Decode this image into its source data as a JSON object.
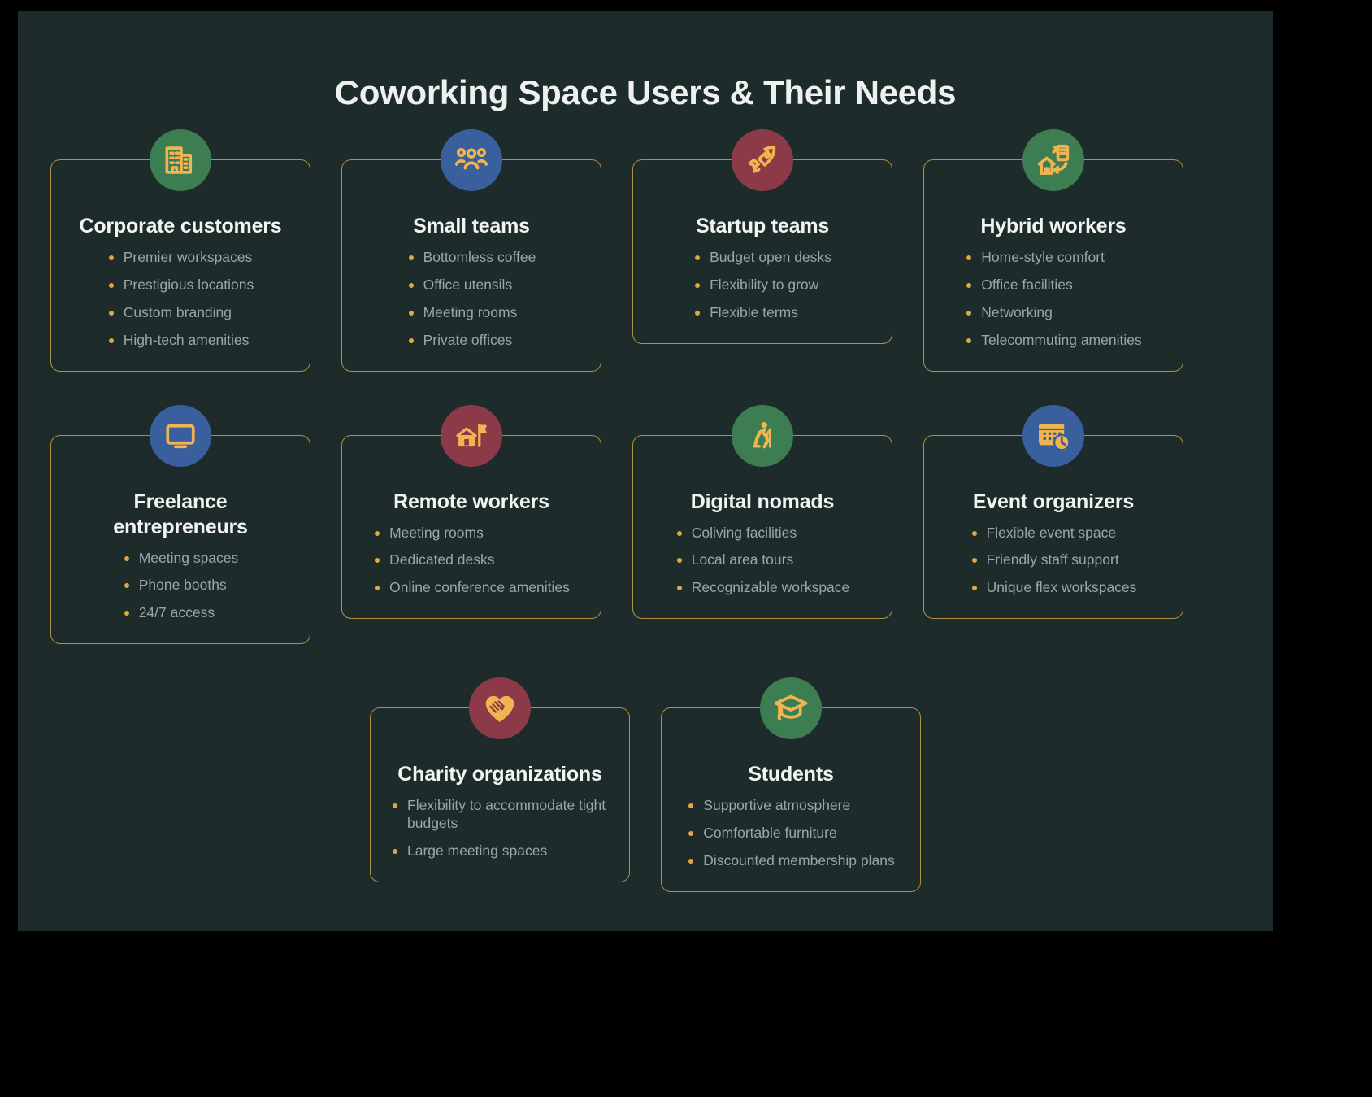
{
  "page": {
    "title": "Coworking Space Users & Their Needs",
    "background_color": "#1d2c2b",
    "outer_color": "#000000",
    "card_border_color": "#b09042",
    "bullet_color": "#e0a93f",
    "title_color": "#eef1ef",
    "body_text_color": "#9aa6a8"
  },
  "badge_colors": {
    "green": "#3d7d52",
    "blue": "#3a5f9e",
    "maroon": "#8c3a48",
    "icon": "#f0b450"
  },
  "rows": [
    {
      "cards": [
        {
          "title": "Corporate customers",
          "icon": "office-building-icon",
          "badge_color": "#3d7d52",
          "needs": [
            "Premier workspaces",
            "Prestigious locations",
            "Custom branding",
            "High-tech amenities"
          ]
        },
        {
          "title": "Small teams",
          "icon": "people-group-icon",
          "badge_color": "#3a5f9e",
          "needs": [
            "Bottomless coffee",
            "Office utensils",
            "Meeting rooms",
            "Private offices"
          ]
        },
        {
          "title": "Startup teams",
          "icon": "rocket-icon",
          "badge_color": "#8c3a48",
          "needs": [
            "Budget open desks",
            "Flexibility to grow",
            "Flexible terms"
          ]
        },
        {
          "title": "Hybrid workers",
          "icon": "home-office-exchange-icon",
          "badge_color": "#3d7d52",
          "needs": [
            "Home-style comfort",
            "Office facilities",
            "Networking",
            "Telecommuting amenities"
          ]
        }
      ]
    },
    {
      "cards": [
        {
          "title": "Freelance entrepreneurs",
          "icon": "laptop-icon",
          "badge_color": "#3a5f9e",
          "needs": [
            "Meeting spaces",
            "Phone booths",
            "24/7 access"
          ]
        },
        {
          "title": "Remote workers",
          "icon": "house-flag-icon",
          "badge_color": "#8c3a48",
          "needs": [
            "Meeting rooms",
            "Dedicated desks",
            "Online conference amenities"
          ]
        },
        {
          "title": "Digital nomads",
          "icon": "hiker-icon",
          "badge_color": "#3d7d52",
          "needs": [
            "Coliving facilities",
            "Local area tours",
            "Recognizable workspace"
          ]
        },
        {
          "title": "Event organizers",
          "icon": "calendar-clock-icon",
          "badge_color": "#3a5f9e",
          "needs": [
            "Flexible event space",
            "Friendly staff support",
            "Unique flex workspaces"
          ]
        }
      ]
    },
    {
      "cards": [
        {
          "title": "Charity organizations",
          "icon": "handshake-heart-icon",
          "badge_color": "#8c3a48",
          "needs": [
            "Flexibility to accommodate tight budgets",
            "Large meeting spaces"
          ]
        },
        {
          "title": "Students",
          "icon": "graduation-cap-icon",
          "badge_color": "#3d7d52",
          "needs": [
            "Supportive atmosphere",
            "Comfortable furniture",
            "Discounted membership plans"
          ]
        }
      ]
    }
  ]
}
